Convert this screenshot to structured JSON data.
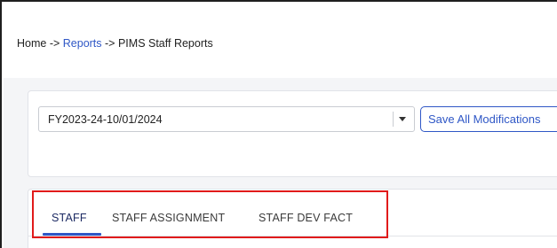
{
  "breadcrumb": {
    "home": "Home",
    "sep1": " -> ",
    "reports": "Reports",
    "sep2": " -> ",
    "current": "PIMS Staff Reports"
  },
  "period_select": {
    "value": "FY2023-24-10/01/2024",
    "icon": "caret-down-icon"
  },
  "save_button": {
    "label": "Save All Modifications"
  },
  "tabs": [
    {
      "label": "STAFF",
      "active": true
    },
    {
      "label": "STAFF ASSIGNMENT",
      "active": false
    },
    {
      "label": "STAFF DEV FACT",
      "active": false
    }
  ],
  "colors": {
    "accent": "#2f57c6",
    "highlight_box": "#e11b1b",
    "content_bg": "#f4f5f7"
  }
}
